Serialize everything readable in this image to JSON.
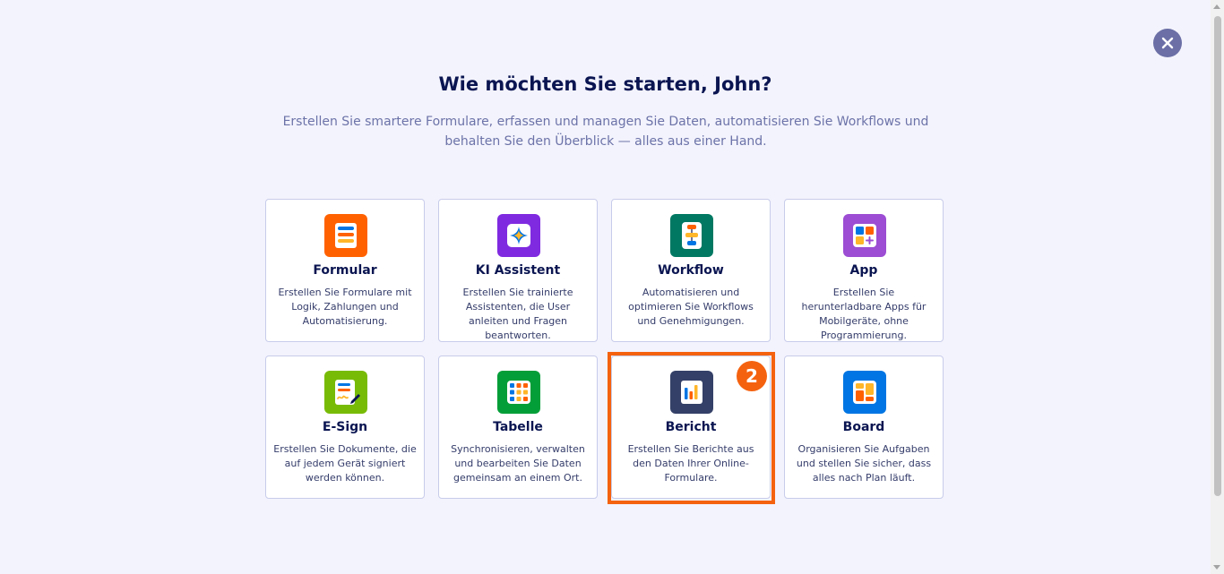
{
  "header": {
    "title": "Wie möchten Sie starten, John?",
    "subtitle": "Erstellen Sie smartere Formulare, erfassen und managen Sie Daten, automatisieren Sie Workflows und behalten Sie den Überblick — alles aus einer Hand."
  },
  "close_button": {
    "icon": "close-icon"
  },
  "cards": [
    {
      "title": "Formular",
      "description": "Erstellen Sie Formulare mit Logik, Zahlungen und Automatisierung.",
      "icon": "form-icon",
      "icon_color": "#ff6100"
    },
    {
      "title": "KI Assistent",
      "description": "Erstellen Sie trainierte Assistenten, die User anleiten und Fragen beantworten.",
      "icon": "ai-agent-icon",
      "icon_color": "#7f2ae0"
    },
    {
      "title": "Workflow",
      "description": "Automatisieren und optimieren Sie Workflows und Genehmigungen.",
      "icon": "workflow-icon",
      "icon_color": "#007862"
    },
    {
      "title": "App",
      "description": "Erstellen Sie herunterladbare Apps für Mobilgeräte, ohne Programmierung.",
      "icon": "app-icon",
      "icon_color": "#9c4dd3"
    },
    {
      "title": "E-Sign",
      "description": "Erstellen Sie Dokumente, die auf jedem Gerät signiert werden können.",
      "icon": "esign-icon",
      "icon_color": "#78bb07"
    },
    {
      "title": "Tabelle",
      "description": "Synchronisieren, verwalten und bearbeiten Sie Daten gemeinsam an einem Ort.",
      "icon": "table-icon",
      "icon_color": "#049e38"
    },
    {
      "title": "Bericht",
      "description": "Erstellen Sie Berichte aus den Daten Ihrer Online-Formulare.",
      "icon": "report-icon",
      "icon_color": "#344067"
    },
    {
      "title": "Board",
      "description": "Organisieren Sie Aufgaben und stellen Sie sicher, dass alles nach Plan läuft.",
      "icon": "board-icon",
      "icon_color": "#0075e3"
    }
  ],
  "step_badge": {
    "label": "2",
    "color": "#f5620f"
  }
}
